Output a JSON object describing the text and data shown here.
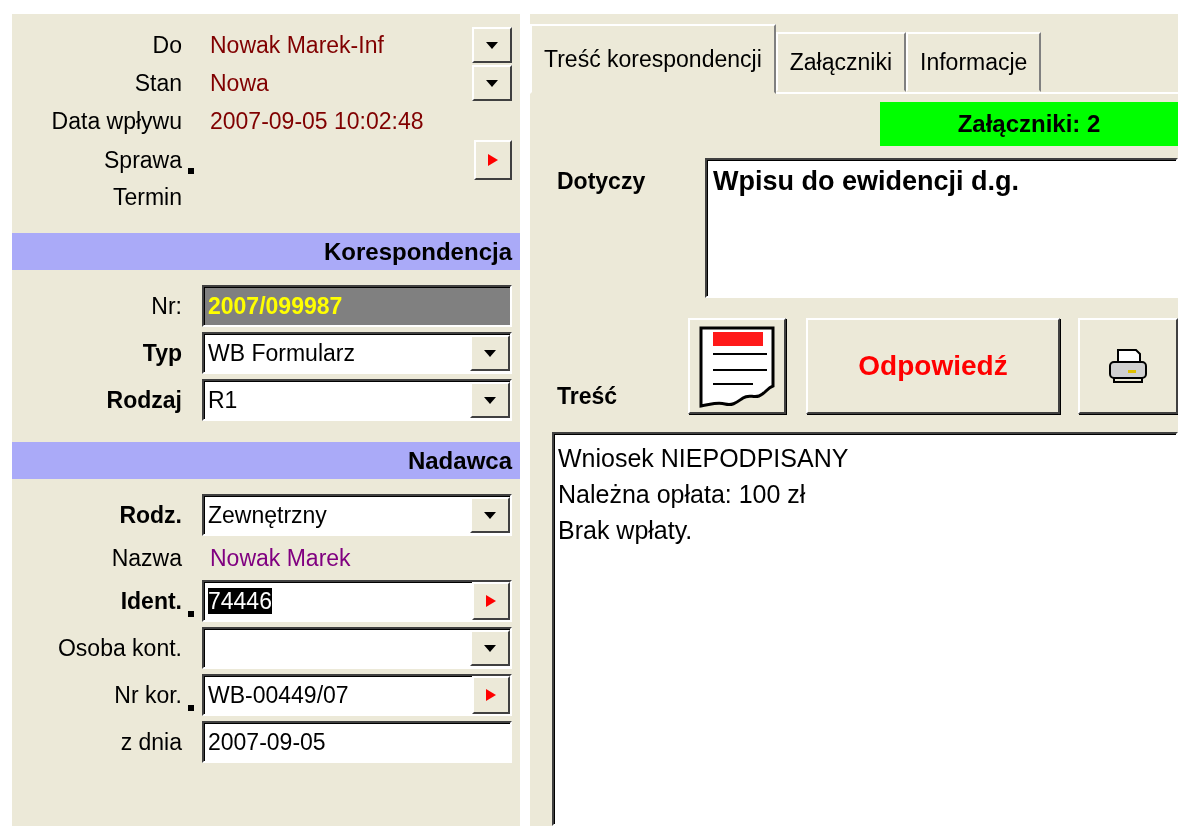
{
  "header_fields": [
    {
      "kind": "dropdown",
      "label": "Do",
      "value": "Nowak Marek-Inf",
      "marked": false
    },
    {
      "kind": "dropdown",
      "label": "Stan",
      "value": "Nowa",
      "marked": false
    },
    {
      "kind": "plain",
      "label": "Data wpływu",
      "value": "2007-09-05 10:02:48",
      "marked": false
    },
    {
      "kind": "lookup",
      "label": "Sprawa",
      "marked": true
    },
    {
      "kind": "plain",
      "label": "Termin",
      "marked": false
    }
  ],
  "sections": [
    {
      "title": "Korespondencja",
      "fields": [
        {
          "kind": "readonly",
          "label": "Nr:",
          "bold": false,
          "marked": false,
          "value": "2007/099987"
        },
        {
          "kind": "combo",
          "label": "Typ",
          "bold": true,
          "marked": false,
          "value": "WB Formularz"
        },
        {
          "kind": "combo",
          "label": "Rodzaj",
          "bold": true,
          "marked": false,
          "value": "R1"
        }
      ]
    },
    {
      "title": "Nadawca",
      "fields": [
        {
          "kind": "combo",
          "label": "Rodz.",
          "bold": true,
          "marked": false,
          "value": "Zewnętrzny"
        },
        {
          "kind": "name",
          "label": "Nazwa",
          "bold": false,
          "marked": false,
          "value": "Nowak Marek"
        },
        {
          "kind": "input_arrow",
          "label": "Ident.",
          "bold": true,
          "marked": true,
          "value": "74446",
          "highlighted": true
        },
        {
          "kind": "combo",
          "label": "Osoba kont.",
          "bold": false,
          "marked": false
        },
        {
          "kind": "input_arrow",
          "label": "Nr kor.",
          "bold": false,
          "marked": true,
          "value": "WB-00449/07",
          "highlighted": false
        },
        {
          "kind": "input",
          "label": "z dnia",
          "bold": false,
          "marked": false,
          "value": "2007-09-05"
        }
      ]
    }
  ],
  "tabs": [
    {
      "label": "Treść korespondencji",
      "selected": true
    },
    {
      "label": "Załączniki",
      "selected": false
    },
    {
      "label": "Informacje",
      "selected": false
    }
  ],
  "attachments_badge": "Załączniki: 2",
  "subject": {
    "label": "Dotyczy",
    "value": "Wpisu do ewidencji d.g."
  },
  "content": {
    "label": "Treść",
    "lines": [
      "Wniosek NIEPODPISANY",
      "Należna opłata: 100 zł",
      "Brak wpłaty."
    ]
  },
  "reply_button": "Odpowiedź"
}
